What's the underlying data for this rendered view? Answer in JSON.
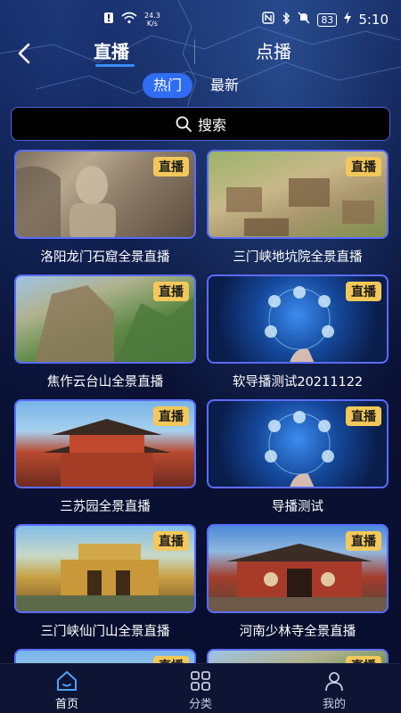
{
  "status_bar": {
    "network_speed_value": "24.3",
    "network_speed_unit": "K/s",
    "battery": "83",
    "time": "5:10"
  },
  "top_tabs": [
    {
      "label": "直播",
      "active": true
    },
    {
      "label": "点播",
      "active": false
    }
  ],
  "sub_tabs": [
    {
      "label": "热门",
      "active": true
    },
    {
      "label": "最新",
      "active": false
    }
  ],
  "search": {
    "placeholder": "搜索"
  },
  "badge_label": "直播",
  "cards": [
    {
      "title": "洛阳龙门石窟全景直播",
      "image": "buddha-statue"
    },
    {
      "title": "三门峡地坑院全景直播",
      "image": "cave-dwellings"
    },
    {
      "title": "焦作云台山全景直播",
      "image": "mountain-cliff"
    },
    {
      "title": "软导播测试20211122",
      "image": "tech-globe"
    },
    {
      "title": "三苏园全景直播",
      "image": "pagoda"
    },
    {
      "title": "导播测试",
      "image": "tech-globe"
    },
    {
      "title": "三门峡仙门山全景直播",
      "image": "scenic-gate"
    },
    {
      "title": "河南少林寺全景直播",
      "image": "temple"
    }
  ],
  "bottom_nav": [
    {
      "label": "首页",
      "icon": "home-icon",
      "active": true
    },
    {
      "label": "分类",
      "icon": "grid-icon",
      "active": false
    },
    {
      "label": "我的",
      "icon": "user-icon",
      "active": false
    }
  ],
  "colors": {
    "accent": "#2f6df5",
    "badge": "#f3c85a",
    "card_border": "#5b6cff",
    "background": "#0a1236"
  }
}
